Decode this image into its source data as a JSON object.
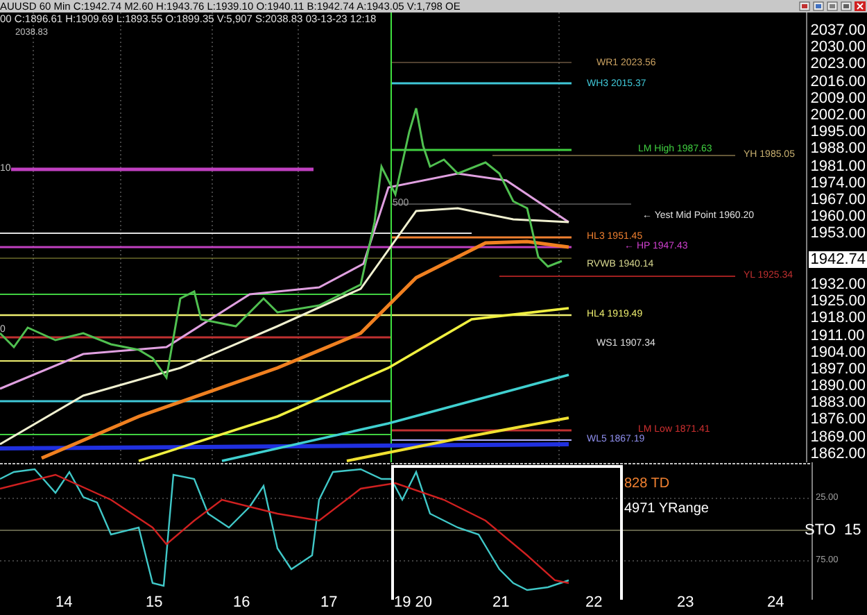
{
  "header": {
    "quote_line": "AUUSD 60 Min C:1942.74 M2.60 H:1943.76 L:1939.10 O:1940.11 B:1942.74 A:1943.05 V:1,798 OE",
    "detail_line": "00 C:1896.61 H:1909.69 L:1893.55 O:1899.35 V:5,907 S:2038.83 03-13-23 12:18",
    "chart_tag": "2038.83"
  },
  "edge_labels": [
    "10",
    "0"
  ],
  "level_labels": [
    {
      "text": "WR1 2023.56",
      "color": "#c8a060"
    },
    {
      "text": "WH3 2015.37",
      "color": "#40c8d8"
    },
    {
      "text": "LM High 1987.63",
      "color": "#40d040"
    },
    {
      "text": "YH 1985.05",
      "color": "#c8b070"
    },
    {
      "text": "500",
      "color": "#a0a0a0"
    },
    {
      "text": "← Yest Mid Point 1960.20",
      "color": "#e0e0e0"
    },
    {
      "text": "HL3 1951.45",
      "color": "#f08030"
    },
    {
      "text": "← HP 1947.43",
      "color": "#d040d0"
    },
    {
      "text": "RVWB 1940.14",
      "color": "#d8d890"
    },
    {
      "text": "YL 1925.34",
      "color": "#c03030"
    },
    {
      "text": "HL4 1919.49",
      "color": "#f0f070"
    },
    {
      "text": "WS1 1907.34",
      "color": "#e0e0e0"
    },
    {
      "text": "LM Low 1871.41",
      "color": "#d03030"
    },
    {
      "text": "WL5 1867.19",
      "color": "#9090f0"
    }
  ],
  "price_axis": {
    "ticks": [
      "2037.00",
      "2030.00",
      "2023.00",
      "2016.00",
      "2009.00",
      "2002.00",
      "1995.00",
      "1988.00",
      "1981.00",
      "1974.00",
      "1967.00",
      "1960.00",
      "1953.00",
      "1932.00",
      "1925.00",
      "1918.00",
      "1911.00",
      "1904.00",
      "1897.00",
      "1890.00",
      "1883.00",
      "1876.00",
      "1869.00",
      "1862.00"
    ],
    "current_price": "1942.74"
  },
  "indicator": {
    "labels": [
      {
        "text": "828 TD",
        "color": "#f08030"
      },
      {
        "text": "4971 YRange",
        "color": "#ffffff"
      }
    ],
    "ticks": [
      "25.00",
      "75.00"
    ],
    "name": "STO  15"
  },
  "time_axis": [
    "14",
    "15",
    "16",
    "17",
    "19 20",
    "21",
    "22",
    "23",
    "24"
  ]
}
